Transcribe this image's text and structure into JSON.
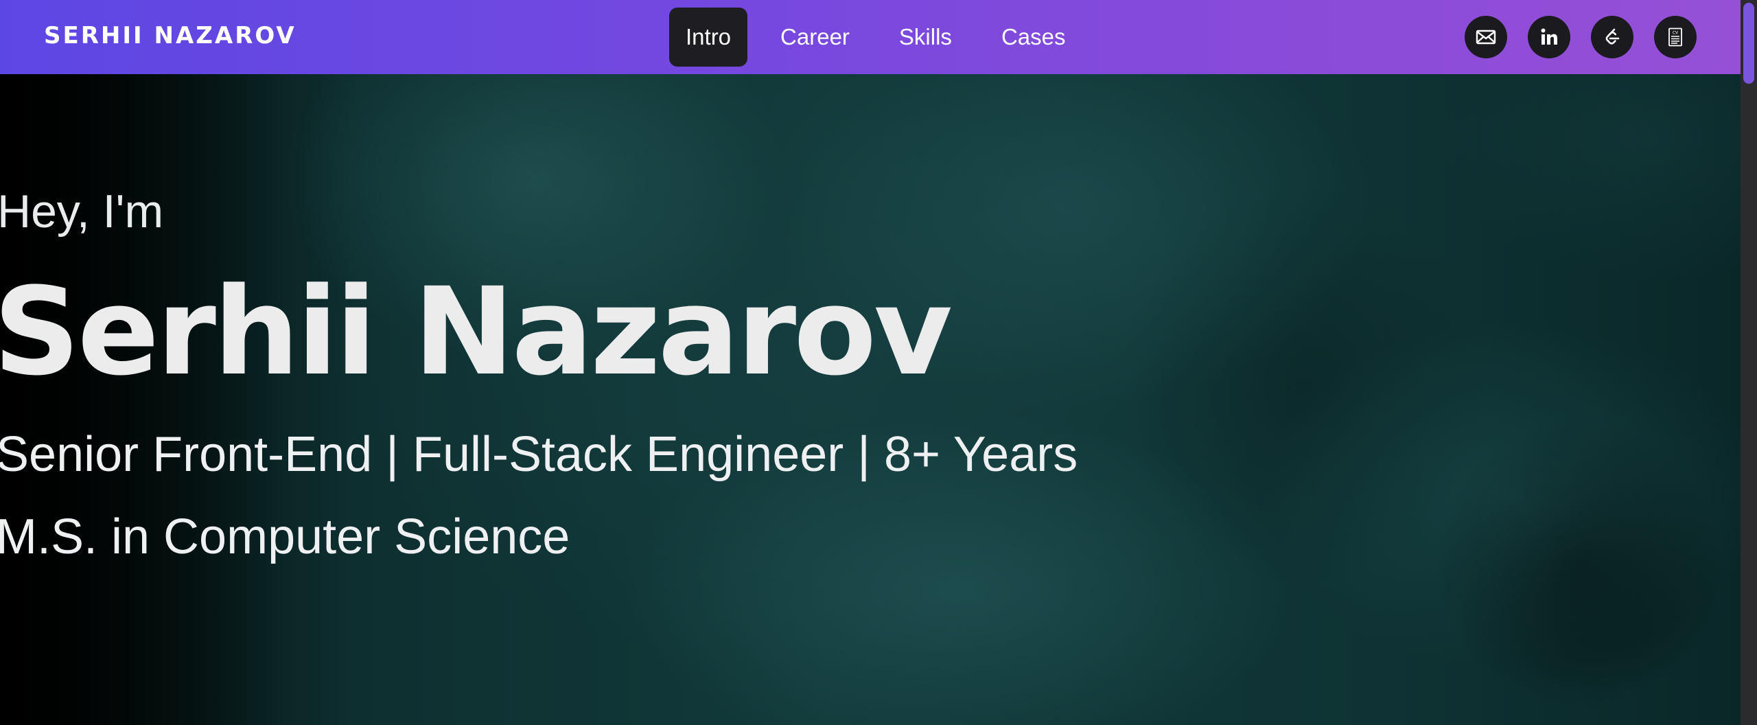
{
  "brand": {
    "logo_text": "SERHII NAZAROV"
  },
  "nav": {
    "items": [
      {
        "label": "Intro",
        "active": true
      },
      {
        "label": "Career",
        "active": false
      },
      {
        "label": "Skills",
        "active": false
      },
      {
        "label": "Cases",
        "active": false
      }
    ]
  },
  "social_icons": [
    {
      "icon": "mail-icon",
      "label": "email"
    },
    {
      "icon": "linkedin-icon",
      "label": "LinkedIn"
    },
    {
      "icon": "leetcode-icon",
      "label": "LeetCode"
    },
    {
      "icon": "cv-document-icon",
      "label": "CV"
    }
  ],
  "hero": {
    "greeting": "Hey, I'm",
    "name": "Serhii Nazarov",
    "role": "Senior Front-End | Full-Stack Engineer | 8+ Years",
    "degree": "M.S. in Computer Science"
  },
  "colors": {
    "topbar_gradient_start": "#5d47e4",
    "topbar_gradient_end": "#9550d6",
    "active_tab_bg": "#1e1e22",
    "icon_button_bg": "#1b1b1f",
    "hero_bg": "#123a3b",
    "text": "#ececed"
  }
}
